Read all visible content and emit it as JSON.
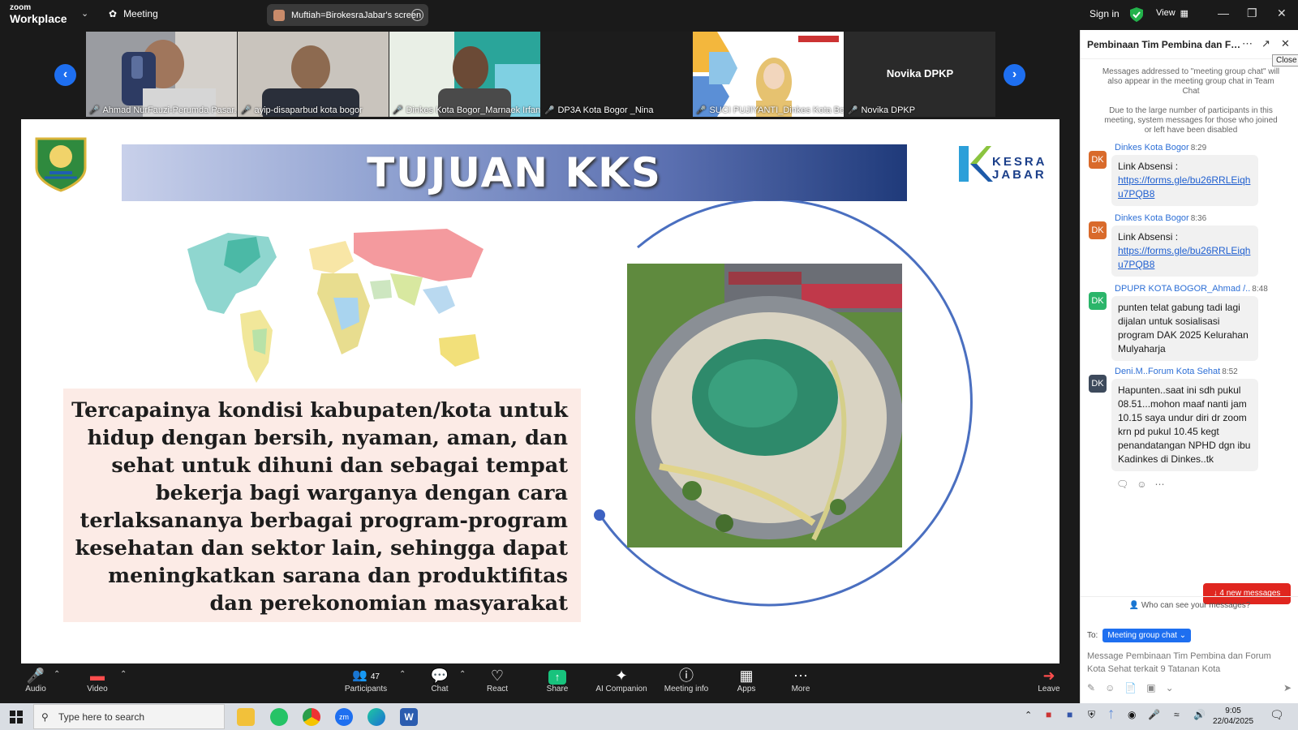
{
  "topbar": {
    "logo_small": "zoom",
    "logo_big": "Workplace",
    "meeting_label": "Meeting",
    "share_label": "Muftiah=BirokesraJabar's screen",
    "sign_in": "Sign in",
    "view_label": "View"
  },
  "gallery": {
    "tiles": [
      {
        "name": "Ahmad NurFauzi-Perumda Pasar..."
      },
      {
        "name": "ayip-disaparbud kota bogor"
      },
      {
        "name": "Dinkes Kota Bogor_Marnaek Irfan"
      },
      {
        "name": "DP3A Kota Bogor _Nina"
      },
      {
        "name": "SUCI PUJIYANTI_Dinkes Kota Bog..."
      },
      {
        "name": "Novika DPKP",
        "center_text": "Novika DPKP"
      }
    ]
  },
  "slide": {
    "title": "TUJUAN KKS",
    "logo_lines": [
      "KESRA",
      "JABAR"
    ],
    "body_lines": [
      "Tercapainya kondisi kabupaten/kota untuk",
      "hidup dengan bersih, nyaman, aman, dan",
      "sehat untuk dihuni dan sebagai tempat",
      "bekerja bagi warganya dengan cara",
      "terlaksananya berbagai program-program",
      "kesehatan dan sektor lain, sehingga dapat",
      "meningkatkan sarana dan produktifitas",
      "dan perekonomian masyarakat"
    ]
  },
  "chat": {
    "title": "Pembinaan Tim Pembina dan Foru...",
    "close_tooltip": "Close",
    "system_1": "Messages addressed to \"meeting group chat\" will also appear in the meeting group chat in Team Chat",
    "system_2": "Due to the large number of participants in this meeting, system messages for those who joined or left have been disabled",
    "messages": [
      {
        "initials": "DK",
        "sender": "Dinkes Kota Bogor",
        "time": "8:29",
        "text": "Link Absensi :",
        "link": "https://forms.gle/bu26RRLEiqhu7PQB8"
      },
      {
        "initials": "DK",
        "sender": "Dinkes Kota Bogor",
        "time": "8:36",
        "text": "Link Absensi :",
        "link": "https://forms.gle/bu26RRLEiqhu7PQB8"
      },
      {
        "initials": "DK",
        "sender": "DPUPR KOTA BOGOR_Ahmad /..",
        "time": "8:48",
        "text": "punten telat gabung tadi lagi dijalan untuk sosialisasi program DAK 2025 Kelurahan Mulyaharja"
      },
      {
        "initials": "DK",
        "sender": "Deni.M..Forum Kota Sehat",
        "time": "8:52",
        "text": "Hapunten..saat ini sdh pukul 08.51...mohon maaf nanti jam 10.15 saya undur diri dr zoom krn pd pukul 10.45 kegt penandatangan NPHD dgn ibu Kadinkes di Dinkes..tk"
      }
    ],
    "new_messages": "4 new messages",
    "who_can_see": "Who can see your messages?",
    "to_label": "To:",
    "to_target": "Meeting group chat",
    "composer_placeholder": "Message Pembinaan Tim Pembina dan Forum Kota Sehat terkait 9 Tatanan Kota"
  },
  "toolbar": {
    "audio": "Audio",
    "video": "Video",
    "participants": "Participants",
    "participants_count": "47",
    "chat": "Chat",
    "react": "React",
    "share": "Share",
    "ai_companion": "AI Companion",
    "meeting_info": "Meeting info",
    "apps": "Apps",
    "more": "More",
    "leave": "Leave"
  },
  "taskbar": {
    "search_placeholder": "Type here to search",
    "time": "9:05",
    "date": "22/04/2025"
  },
  "colors": {
    "accent": "#1e6ff0",
    "danger": "#e0261f",
    "share_green": "#18c37d"
  }
}
